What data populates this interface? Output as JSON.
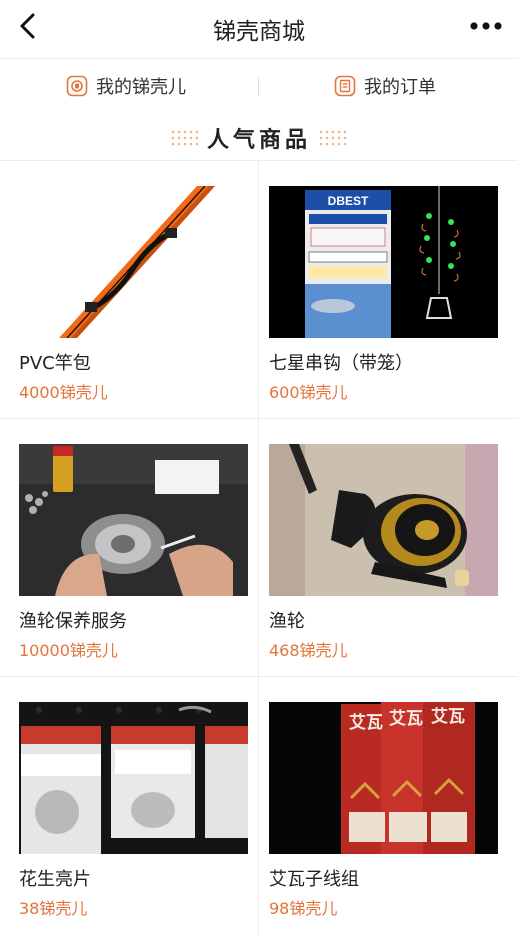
{
  "header": {
    "title": "锑壳商城",
    "back_icon": "chevron-left-icon",
    "more_icon": "more-horizontal-icon"
  },
  "shortcuts": [
    {
      "label": "我的锑壳儿",
      "icon": "coin-icon"
    },
    {
      "label": "我的订单",
      "icon": "order-icon"
    }
  ],
  "section": {
    "title": "人气商品"
  },
  "colors": {
    "accent": "#e3743a",
    "divider": "#ececec",
    "text": "#222222"
  },
  "products": [
    {
      "name": "PVC竿包",
      "price": "4000锑壳儿"
    },
    {
      "name": "七星串钩（带笼）",
      "price": "600锑壳儿",
      "image_text": "DBEST"
    },
    {
      "name": "渔轮保养服务",
      "price": "10000锑壳儿"
    },
    {
      "name": "渔轮",
      "price": "468锑壳儿"
    },
    {
      "name": "花生亮片",
      "price": "38锑壳儿"
    },
    {
      "name": "艾瓦子线组",
      "price": "98锑壳儿",
      "image_text": "艾瓦"
    }
  ]
}
